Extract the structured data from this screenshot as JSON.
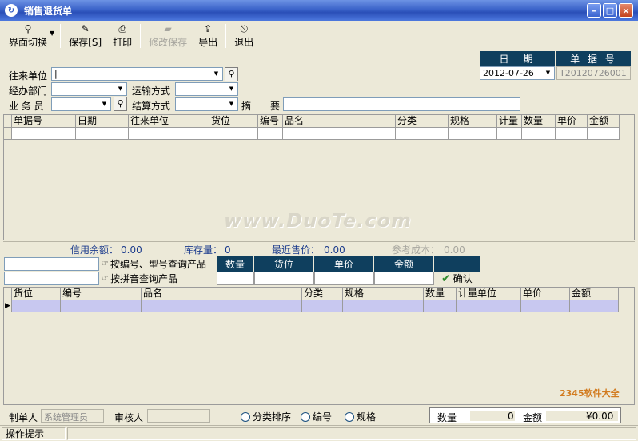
{
  "window": {
    "title": "销售退货单"
  },
  "toolbar": {
    "switch_label": "界面切换",
    "save_label": "保存[S]",
    "print_label": "打印",
    "modify_save_label": "修改保存",
    "export_label": "导出",
    "exit_label": "退出"
  },
  "form": {
    "partner_label": "往来单位",
    "department_label": "经办部门",
    "transport_label": "运输方式",
    "salesman_label": "业 务 员",
    "settlement_label": "结算方式",
    "summary_label": "摘　　要",
    "date_header": "日　期",
    "docno_header": "单 据 号",
    "date_value": "2012-07-26",
    "docno_value": "T20120726001"
  },
  "main_grid": {
    "columns": [
      "单据号",
      "日期",
      "往来单位",
      "货位",
      "编号",
      "品名",
      "分类",
      "规格",
      "计量",
      "数量",
      "单价",
      "金额"
    ]
  },
  "info": {
    "credit_label": "信用余额：",
    "credit_value": "0.00",
    "stock_label": "库存量：",
    "stock_value": "0",
    "last_price_label": "最近售价：",
    "last_price_value": "0.00",
    "ref_cost_label": "参考成本：",
    "ref_cost_value": "0.00"
  },
  "watermark": "www.DuoTe.com",
  "query": {
    "by_code_label": "按编号、型号查询产品",
    "by_pinyin_label": "按拼音查询产品",
    "headers": [
      "数量",
      "货位",
      "单价",
      "金额"
    ],
    "confirm_label": "确认"
  },
  "detail_grid": {
    "columns": [
      "货位",
      "编号",
      "品名",
      "分类",
      "规格",
      "数量",
      "计量单位",
      "单价",
      "金额"
    ]
  },
  "footer": {
    "creator_label": "制单人",
    "creator_value": "系统管理员",
    "reviewer_label": "审核人",
    "sort_category": "分类排序",
    "sort_code": "编号",
    "sort_spec": "规格",
    "qty_label": "数量",
    "qty_value": "0",
    "amount_label": "金额",
    "amount_value": "¥0.00"
  },
  "statusbar": {
    "hint": "操作提示"
  },
  "corner_logo": "2345软件大全"
}
